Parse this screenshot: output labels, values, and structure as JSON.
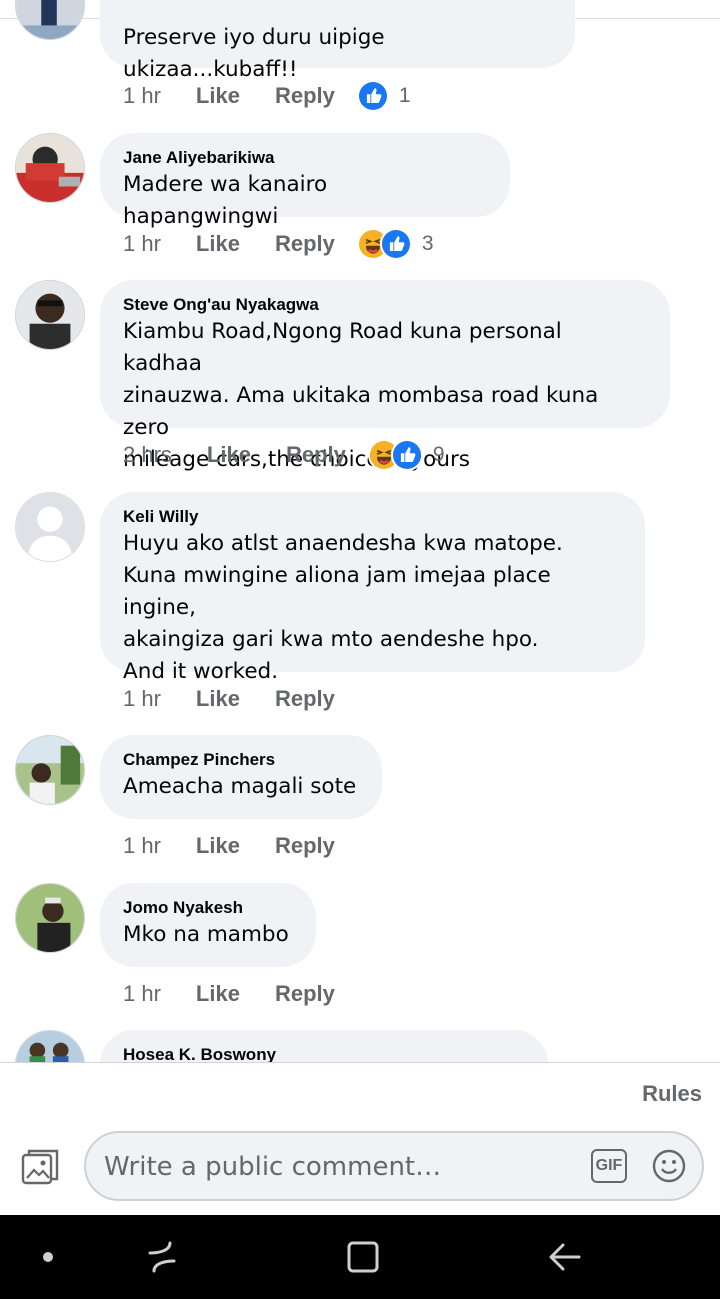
{
  "comments": [
    {
      "author": "",
      "text": "Preserve iyo duru uipige ukizaa...kubaff!!",
      "time": "1 hr",
      "like": "Like",
      "reply": "Reply",
      "reactions": [
        "like"
      ],
      "reaction_count": "1"
    },
    {
      "author": "Jane Aliyebarikiwa",
      "text": "Madere wa kanairo hapangwingwi",
      "time": "1 hr",
      "like": "Like",
      "reply": "Reply",
      "reactions": [
        "haha",
        "like"
      ],
      "reaction_count": "3"
    },
    {
      "author": "Steve Ong'au Nyakagwa",
      "text": "Kiambu Road,Ngong Road kuna personal kadhaa\nzinauzwa. Ama ukitaka mombasa road kuna zero\nmileage cars,the choice is yours",
      "time": "2 hrs",
      "like": "Like",
      "reply": "Reply",
      "reactions": [
        "haha",
        "like"
      ],
      "reaction_count": "9"
    },
    {
      "author": "Keli Willy",
      "text": "Huyu ako atlst anaendesha kwa matope.\nKuna mwingine aliona jam imejaa place ingine,\nakaingiza gari kwa mto aendeshe hpo.\nAnd it worked.",
      "time": "1 hr",
      "like": "Like",
      "reply": "Reply",
      "reactions": [],
      "reaction_count": ""
    },
    {
      "author": "Champez Pinchers",
      "text": "Ameacha magali sote",
      "time": "1 hr",
      "like": "Like",
      "reply": "Reply",
      "reactions": [],
      "reaction_count": ""
    },
    {
      "author": "Jomo Nyakesh",
      "text": "Mko na mambo",
      "time": "1 hr",
      "like": "Like",
      "reply": "Reply",
      "reactions": [],
      "reaction_count": ""
    },
    {
      "author": "Hosea K. Boswony",
      "text": "",
      "time": "",
      "like": "",
      "reply": "",
      "reactions": [],
      "reaction_count": ""
    }
  ],
  "composer": {
    "rules_label": "Rules",
    "placeholder": "Write a public comment…",
    "gif_label": "GIF",
    "photo_icon": "photo-icon",
    "emoji_icon": "smiley-icon"
  },
  "navbar": {
    "icons": [
      "dot-icon",
      "recents-icon",
      "home-icon",
      "back-icon"
    ]
  },
  "colors": {
    "bubble_bg": "#f0f2f5",
    "secondary_text": "#65676b",
    "like_blue": "#1877f2",
    "haha_yellow": "#f7b125"
  }
}
